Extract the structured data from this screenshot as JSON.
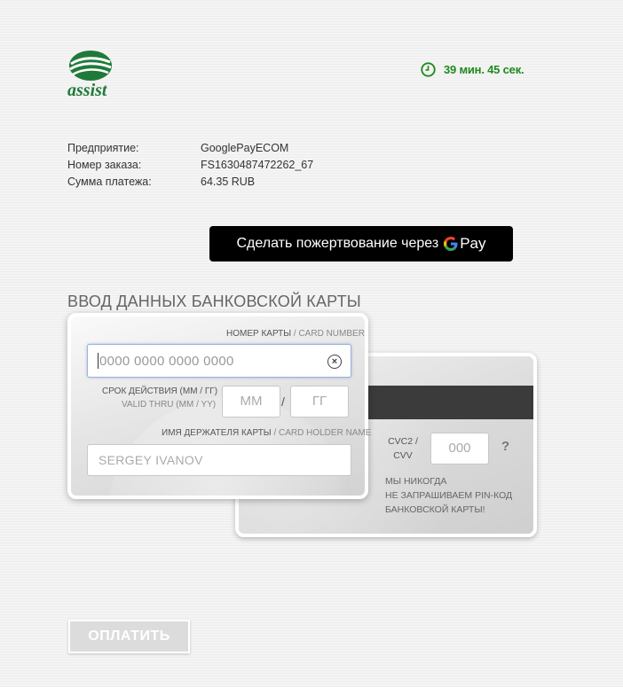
{
  "logo": {
    "text": "assist"
  },
  "timer": {
    "text": "39 мин. 45 сек."
  },
  "order_info": [
    {
      "label": "Предприятие:",
      "value": "GooglePayECOM"
    },
    {
      "label": "Номер заказа:",
      "value": "FS1630487472262_67"
    },
    {
      "label": "Сумма платежа:",
      "value": "64.35 RUB"
    }
  ],
  "gpay": {
    "label": "Сделать пожертвование через",
    "pay": "Pay"
  },
  "section_title": "ВВОД ДАННЫХ БАНКОВСКОЙ КАРТЫ",
  "card_front": {
    "number_caption_ru": "НОМЕР КАРТЫ",
    "number_caption_en": "/ CARD NUMBER",
    "number_placeholder": "0000 0000 0000 0000",
    "expiry_caption_ru": "СРОК ДЕЙСТВИЯ (ММ / ГГ)",
    "expiry_caption_en": "VALID THRU (MM / YY)",
    "month_placeholder": "ММ",
    "year_placeholder": "ГГ",
    "slash": "/",
    "holder_caption_ru": "ИМЯ ДЕРЖАТЕЛЯ КАРТЫ",
    "holder_caption_en": "/ CARD HOLDER NAME",
    "holder_placeholder": "SERGEY IVANOV"
  },
  "card_back": {
    "cvc_label_1": "CVC2 /",
    "cvc_label_2": "CVV",
    "cvc_placeholder": "000",
    "help": "?",
    "pin_note_1": "МЫ НИКОГДА",
    "pin_note_2": "НЕ ЗАПРАШИВАЕМ PIN-КОД",
    "pin_note_3": "БАНКОВСКОЙ КАРТЫ!"
  },
  "pay_button": {
    "label": "ОПЛАТИТЬ"
  },
  "colors": {
    "brand_green": "#1f7a3a",
    "timer_green": "#1e8a1e"
  }
}
